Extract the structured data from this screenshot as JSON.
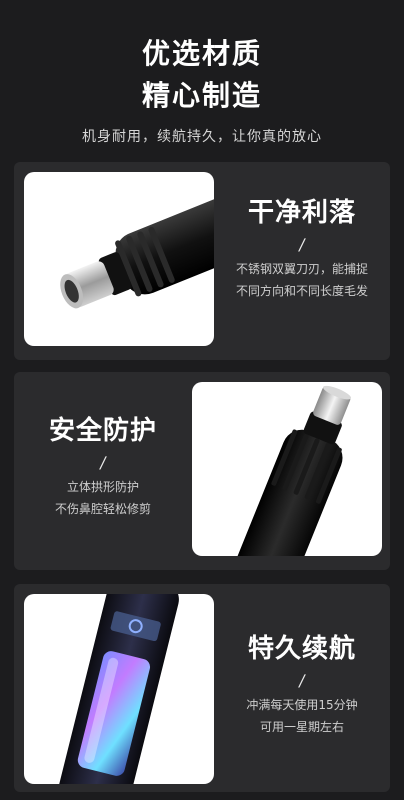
{
  "hero": {
    "title_line1": "优选材质",
    "title_line2": "精心制造",
    "subtitle": "机身耐用，续航持久，让你真的放心"
  },
  "features": [
    {
      "title": "干净利落",
      "slash": "/",
      "line1": "不锈钢双翼刀刃，能捕捉",
      "line2": "不同方向和不同长度毛发"
    },
    {
      "title": "安全防护",
      "slash": "/",
      "line1": "立体拱形防护",
      "line2": "不伤鼻腔轻松修剪"
    },
    {
      "title": "特久续航",
      "slash": "/",
      "line1": "冲满每天使用15分钟",
      "line2": "可用一星期左右"
    }
  ]
}
